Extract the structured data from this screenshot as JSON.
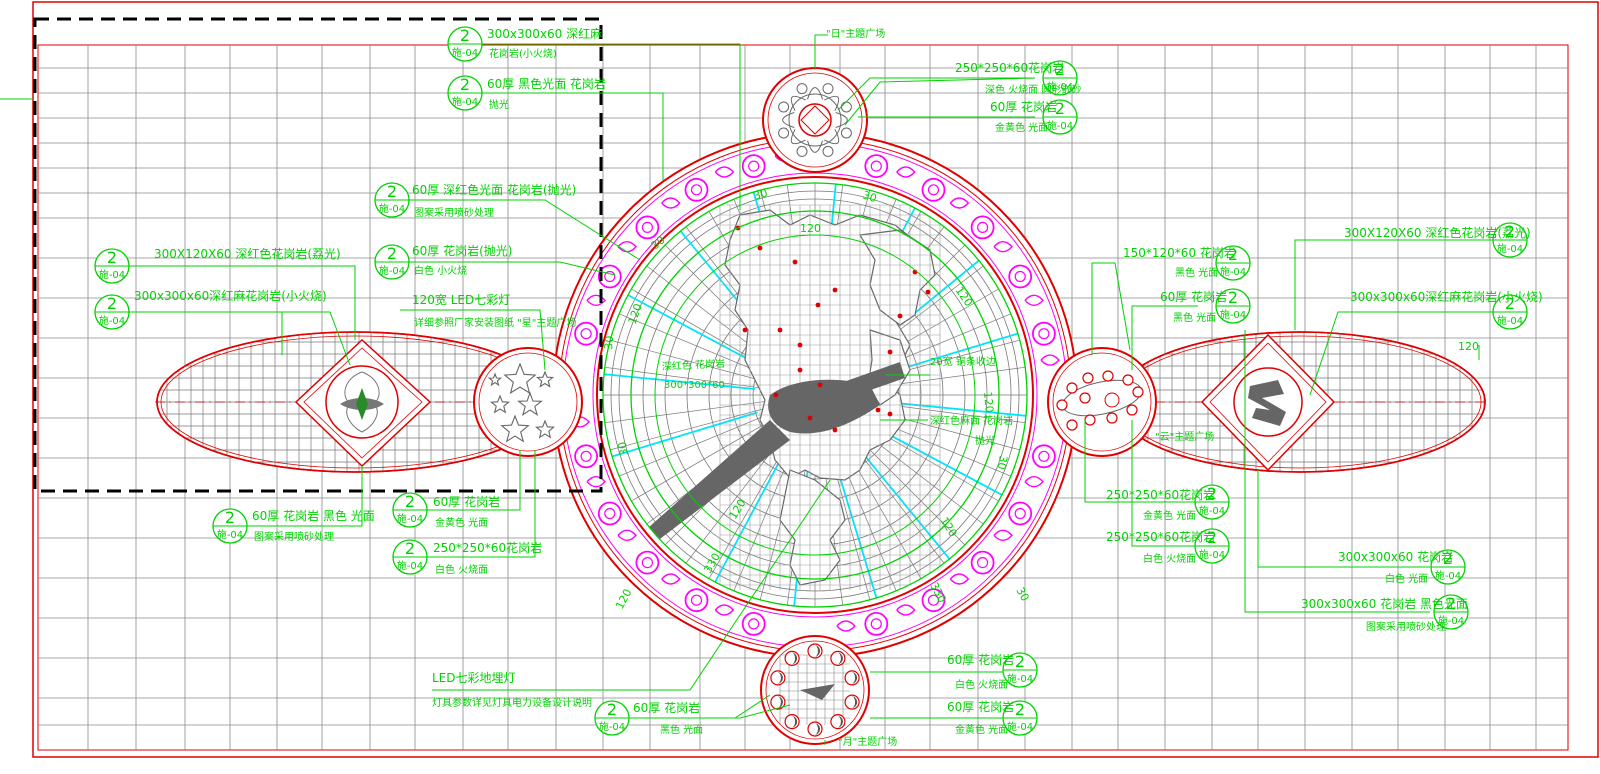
{
  "tag": {
    "num": "2",
    "sub": "施-04"
  },
  "plaza": {
    "sun": "\"日\"主題广场",
    "star": "\"星\"主题广场",
    "cloud": "\"云\"主题广场",
    "moon": "\"月\"主题广场"
  },
  "callouts": {
    "tl1a": "300x300x60  深红麻",
    "tl1b": "花岗岩(小火烧)",
    "tl2a": "60厚  黑色光面  花岗岩",
    "tl2b": "抛光",
    "top1a": "250*250*60花岗岩",
    "top1b": "深色  火烧面  圆形嵌砂",
    "top2a": "60厚  花岗岩",
    "top2b": "金黄色  光面",
    "ml1a": "60厚  深红色光面  花岗岩(抛光)",
    "ml1b": "图案采用喷砂处理",
    "ml2a": "60厚  花岗岩(抛光)",
    "ml2b": "白色  小火烧",
    "led1a": "120宽  LED七彩灯",
    "led1b": "详细参照厂家安装图纸  \"星\"主题广场",
    "left1": "300X120X60  深红色花岗岩(荔光)",
    "left2": "300x300x60深红麻花岗岩(小火烧)",
    "bl1a": "60厚  花岗岩  黑色  光面",
    "bl1b": "图案采用喷砂处理",
    "bl2a": "60厚  花岗岩",
    "bl2b": "金黄色  光面",
    "bl3a": "250*250*60花岗岩",
    "bl3b": "白色  火烧面",
    "c1": "深红色  花岗岩",
    "c2": "300*300*60",
    "c3": "20宽  铜条收边",
    "c4": "深红色麻面  花岗岩",
    "c5": "抛光",
    "r1a": "150*120*60  花岗岩",
    "r1b": "黑色  光面",
    "r2a": "60厚  花岗岩",
    "r2b": "黑色  光面",
    "r3": "300X120X60  深红色花岗岩(荔光)",
    "r4": "300x300x60深红麻花岗岩(小火烧)",
    "r5": "120",
    "rb1a": "250*250*60花岗岩",
    "rb1b": "金黄色  光面",
    "rb2a": "250*250*60花岗岩",
    "rb2b": "白色  火烧面",
    "rb3a": "300x300x60  花岗岩",
    "rb3b": "白色  光面",
    "rb4a": "300x300x60  花岗岩  黑色光面",
    "rb4b": "图案采用喷砂处理",
    "b1a": "LED七彩地埋灯",
    "b1b": "灯具参数详见灯具电力设备设计说明",
    "b2a": "60厚  花岗岩",
    "b2b": "黑色  光面",
    "b3a": "60厚  花岗岩",
    "b3b": "白色  火烧面",
    "b4a": "60厚  花岗岩",
    "b4b": "金黄色  光面"
  },
  "dims": {
    "d120": "120",
    "d30": "30",
    "d330": "330"
  },
  "colors": {
    "gridline": "#888888",
    "frame": "#e00000",
    "annotation": "#00d200",
    "ornament": "#ff00ff",
    "ray": "#00e5ff",
    "fill": "#555555",
    "selection": "#000000"
  }
}
